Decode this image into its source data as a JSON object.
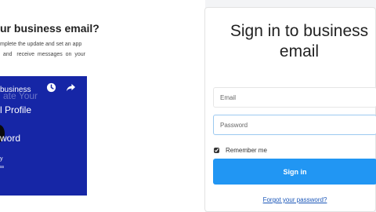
{
  "left": {
    "title": "ur business email?",
    "description": "mplete the update and set an app\n  and   receive  messages  on  your",
    "video": {
      "line1": "business",
      "ghost": "ate Your",
      "line2": "l Profile",
      "line3": "word",
      "line4": "y",
      "line5": "ss",
      "icons": [
        "clock-icon",
        "share-icon"
      ],
      "background": "#1626a6"
    }
  },
  "signin_card": {
    "title": "Sign in to business email",
    "email_placeholder": "Email",
    "password_placeholder": "Password",
    "remember_label": "Remember me",
    "remember_checked": true,
    "signin_label": "Sign in",
    "forgot_label": "Forgot your password?",
    "accent_color": "#2196f3"
  }
}
